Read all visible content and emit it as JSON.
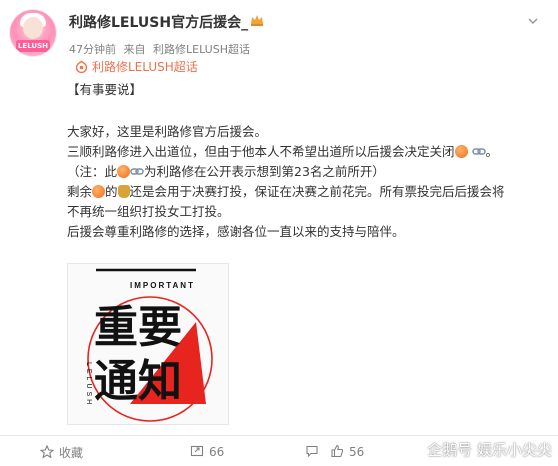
{
  "post": {
    "username": "利路修LELUSH官方后援会_",
    "time": "47分钟前",
    "source_prefix": "来自",
    "source": "利路修LELUSH超话",
    "topic": "利路修LELUSH超话",
    "avatar_badge_text": "LELUSH"
  },
  "content": {
    "heading": "【有事要说】",
    "line1": "大家好，这里是利路修官方后援会。",
    "line2a": "三顺利路修进入出道位，但由于他本人不希望出道所以后援会决定关闭",
    "line2b": "。",
    "line3a": "（注：此",
    "line3b": "为利路修在公开表示想到第23名之前所开）",
    "line4a": "剩余",
    "line4b": "的",
    "line4c": "还是会用于决赛打投，保证在决赛之前花完。所有票投完后后援会将",
    "line5": "不再统一组织打投女工打投。",
    "line6": "后援会尊重利路修的选择，感谢各位一直以来的支持与陪伴。"
  },
  "poster": {
    "tag": "IMPORTANT",
    "side": "LELUSH",
    "line1": "重要",
    "line2": "通知"
  },
  "toolbar": {
    "favorite_label": "收藏",
    "repost_count": "66",
    "comment_count": "",
    "like_count": "56"
  },
  "watermark": "企鹅号 娱乐小尖尖",
  "icons": [
    "crown-icon",
    "chevron-down-icon",
    "supertopic-icon",
    "peach-emoji",
    "link-emoji",
    "money-bag-emoji",
    "star-icon",
    "repost-icon",
    "comment-icon",
    "like-icon"
  ],
  "colors": {
    "accent": "#eb7350",
    "poster_red": "#e8241e",
    "meta": "#808080"
  }
}
